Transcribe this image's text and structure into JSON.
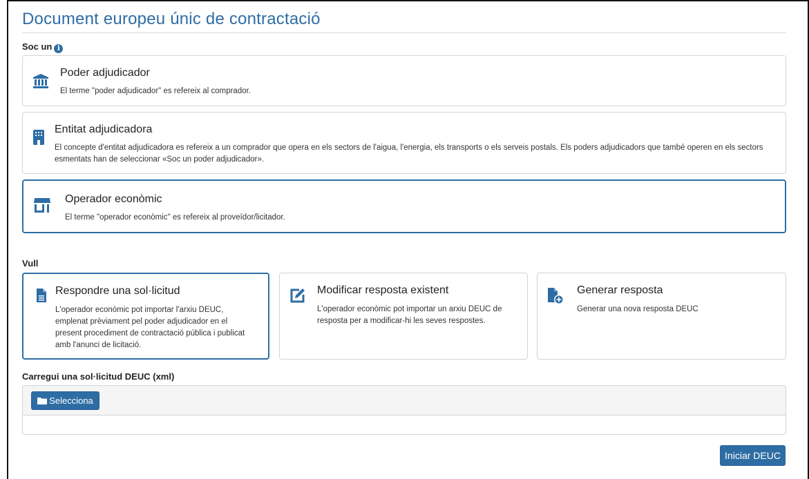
{
  "page": {
    "title": "Document europeu únic de contractació"
  },
  "role_section": {
    "label": "Soc un",
    "info_icon": "info-icon",
    "options": [
      {
        "title": "Poder adjudicador",
        "description": "El terme \"poder adjudicador\" es refereix al comprador.",
        "icon": "institution-icon",
        "selected": false
      },
      {
        "title": "Entitat adjudicadora",
        "description": "El concepte d'entitat adjudicadora es refereix a un comprador que opera en els sectors de l'aigua, l'energia, els transports o els serveis postals. Els poders adjudicadors que també operen en els sectors esmentats han de seleccionar «Soc un poder adjudicador».",
        "icon": "building-icon",
        "selected": false
      },
      {
        "title": "Operador econòmic",
        "description": "El terme \"operador econòmic\" es refereix al proveïdor/licitador.",
        "icon": "store-icon",
        "selected": true
      }
    ]
  },
  "action_section": {
    "label": "Vull",
    "options": [
      {
        "title": "Respondre una sol·licitud",
        "description": "L'operador econòmic pot importar l'arxiu DEUC, emplenat prèviament pel poder adjudicador en el present procediment de contractació pública i publicat amb l'anunci de licitació.",
        "icon": "file-text-icon",
        "selected": true
      },
      {
        "title": "Modificar resposta existent",
        "description": "L'operador econòmic pot importar un arxiu DEUC de resposta per a modificar-hi les seves respostes.",
        "icon": "edit-icon",
        "selected": false
      },
      {
        "title": "Generar resposta",
        "description": "Generar una nova resposta DEUC",
        "icon": "file-add-icon",
        "selected": false
      }
    ]
  },
  "upload": {
    "label": "Carregui una sol·licitud DEUC (xml)",
    "select_button": "Selecciona",
    "select_icon": "folder-icon"
  },
  "footer": {
    "start_button": "Iniciar DEUC"
  },
  "colors": {
    "accent": "#2e6da4",
    "border": "#d4d4d4"
  }
}
